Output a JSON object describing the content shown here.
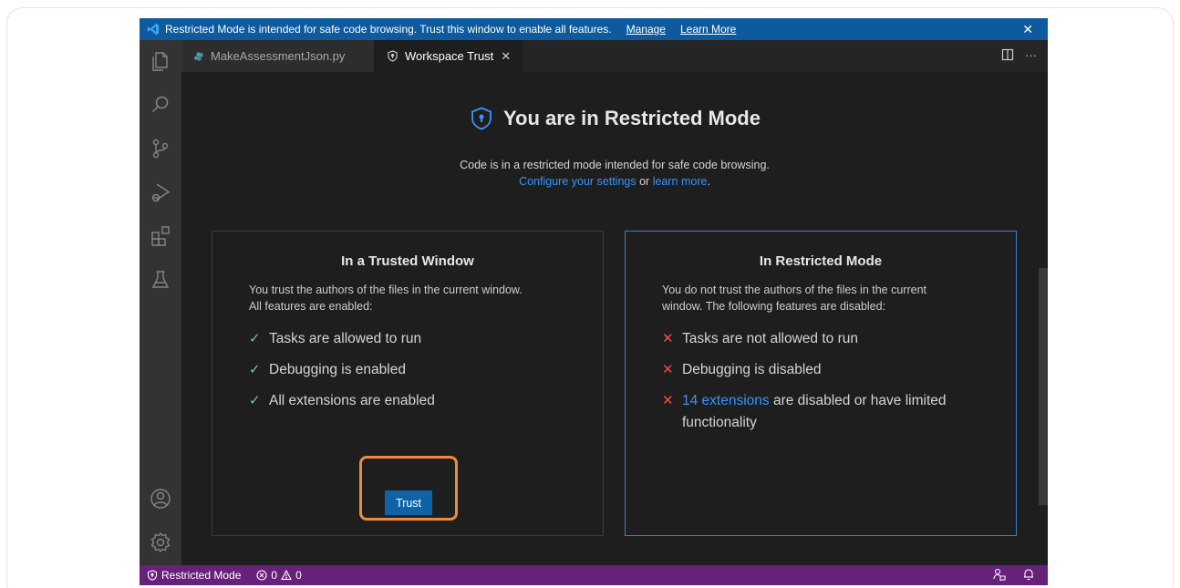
{
  "banner": {
    "message": "Restricted Mode is intended for safe code browsing. Trust this window to enable all features.",
    "manage_link": "Manage",
    "learn_more_link": "Learn More",
    "close_glyph": "✕"
  },
  "tabs": [
    {
      "label": "MakeAssessmentJson.py",
      "active": false,
      "icon": "python-file-icon"
    },
    {
      "label": "Workspace Trust",
      "active": true,
      "icon": "shield-icon"
    }
  ],
  "tab_close_glyph": "✕",
  "editor_actions": [
    "split-editor-icon",
    "more-actions-icon"
  ],
  "more_glyph": "···",
  "page": {
    "title": "You are in Restricted Mode",
    "subtitle_line1": "Code is in a restricted mode intended for safe code browsing.",
    "configure_link": "Configure your settings",
    "or_text": " or ",
    "learn_more_link": "learn more",
    "period": "."
  },
  "trusted_card": {
    "heading": "In a Trusted Window",
    "desc_line1": "You trust the authors of the files in the current window.",
    "desc_line2": "All features are enabled:",
    "items": [
      "Tasks are allowed to run",
      "Debugging is enabled",
      "All extensions are enabled"
    ],
    "button_label": "Trust"
  },
  "restricted_card": {
    "heading": "In Restricted Mode",
    "desc_line1": "You do not trust the authors of the files in the current",
    "desc_line2": "window. The following features are disabled:",
    "items": [
      "Tasks are not allowed to run",
      "Debugging is disabled"
    ],
    "ext_link": "14 extensions",
    "ext_rest": " are disabled or have limited functionality"
  },
  "check_glyph": "✓",
  "cross_glyph": "✕",
  "statusbar": {
    "mode_label": "Restricted Mode",
    "errors": "0",
    "warnings": "0"
  },
  "colors": {
    "banner": "#0e5a9e",
    "status_bar": "#68217a",
    "link": "#3794ff",
    "ok": "#73c991",
    "no": "#f14c4c",
    "highlight": "#f08a3b",
    "button": "#0e63a7"
  }
}
